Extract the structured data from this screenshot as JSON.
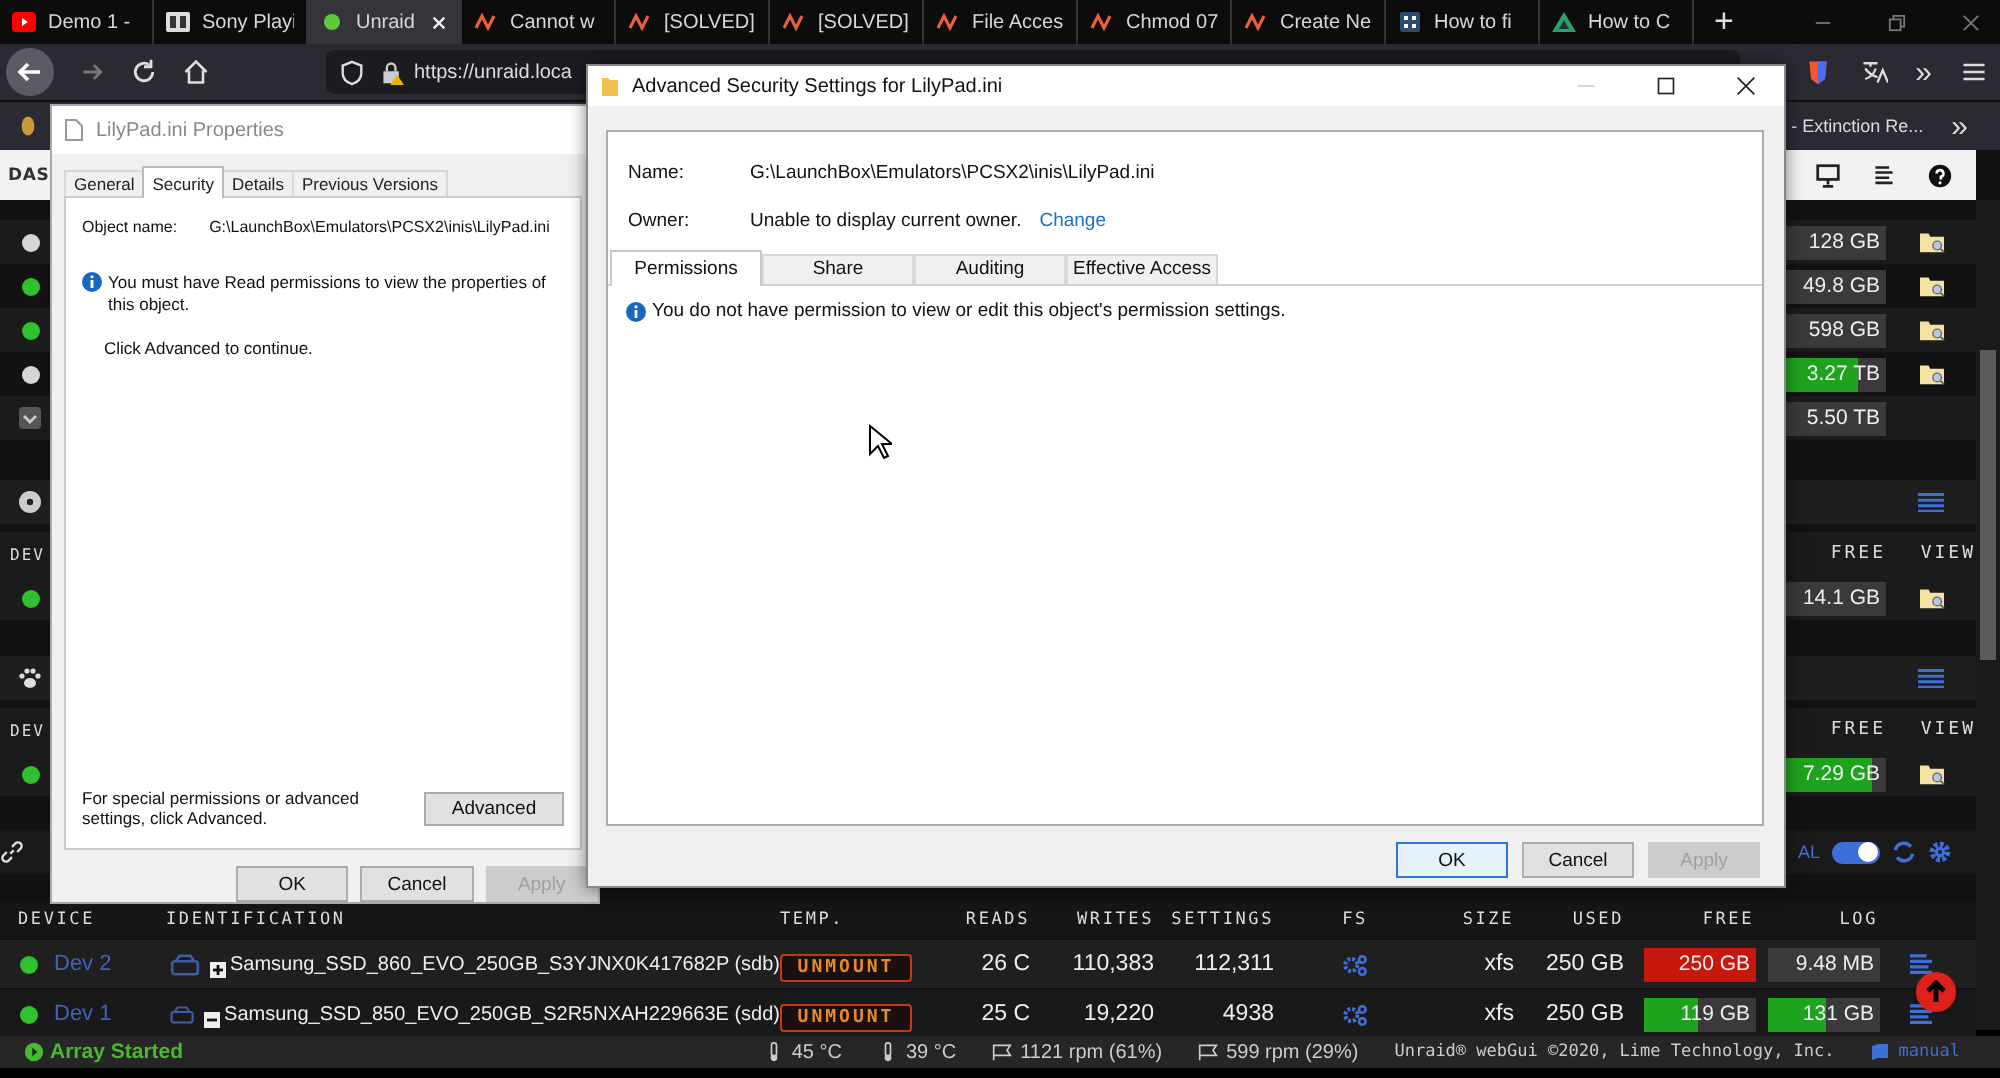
{
  "browser": {
    "tabs": [
      {
        "title": "Demo 1 -",
        "kind": "video",
        "selected": false
      },
      {
        "title": "Sony Playi",
        "kind": "letters",
        "selected": false
      },
      {
        "title": "Unraid",
        "kind": "dot",
        "selected": true
      },
      {
        "title": "Cannot w",
        "kind": "wave",
        "selected": false
      },
      {
        "title": "[SOLVED]",
        "kind": "wave",
        "selected": false
      },
      {
        "title": "[SOLVED]",
        "kind": "wave",
        "selected": false
      },
      {
        "title": "File Acces",
        "kind": "wave",
        "selected": false
      },
      {
        "title": "Chmod 07",
        "kind": "wave",
        "selected": false
      },
      {
        "title": "Create Ne",
        "kind": "wave",
        "selected": false
      },
      {
        "title": "How to fi",
        "kind": "grid",
        "selected": false
      },
      {
        "title": "How to C",
        "kind": "triangle",
        "selected": false
      }
    ],
    "new_tab": "+",
    "url": "https://unraid.loca",
    "bookmark": "- Extinction Re...",
    "bookmarks_more": "»",
    "toolbar_more": "»"
  },
  "page": {
    "title": "DAS",
    "array_rows": [
      {
        "kind": "disk",
        "color": "#d6d6d6",
        "free": "128 GB"
      },
      {
        "kind": "disk",
        "color": "#2fc12f",
        "free": "49.8 GB"
      },
      {
        "kind": "disk",
        "color": "#2fc12f",
        "free": "598 GB"
      },
      {
        "kind": "disk",
        "color": "#d6d6d6",
        "free": "3.27 TB",
        "level": 0.72
      },
      {
        "kind": "total",
        "free": "5.50 TB"
      }
    ],
    "sections": [
      {
        "kind": "disc",
        "column_1": "DEV",
        "free_label": "FREE",
        "view_label": "VIEW",
        "rows": [
          {
            "color": "#2fc12f",
            "free": "14.1 GB"
          }
        ]
      },
      {
        "kind": "paw",
        "column_1": "DEV",
        "free_label": "FREE",
        "view_label": "VIEW",
        "rows": [
          {
            "color": "#2fc12f",
            "free": "7.29 GB",
            "level": 0.86
          }
        ]
      }
    ],
    "toolbar": {
      "label": "AL",
      "toggle_on": true
    },
    "devices": {
      "columns": [
        "DEVICE",
        "IDENTIFICATION",
        "TEMP.",
        "READS",
        "WRITES",
        "SETTINGS",
        "FS",
        "SIZE",
        "USED",
        "FREE",
        "LOG"
      ],
      "rows": [
        {
          "color": "#2fc12f",
          "device": "Dev 2",
          "expanded": false,
          "identification": "Samsung_SSD_860_EVO_250GB_S3YJNX0K417682P (sdb)",
          "action": "UNMOUNT",
          "temp": "26 C",
          "reads": "110,383",
          "writes": "112,311",
          "fs": "xfs",
          "size": "250 GB",
          "used": {
            "text": "250 GB",
            "level": 1
          },
          "free": {
            "text": "9.48 MB"
          }
        },
        {
          "color": "#2fc12f",
          "device": "Dev 1",
          "expanded": true,
          "identification": "Samsung_SSD_850_EVO_250GB_S2R5NXAH229663E (sdd)",
          "action": "UNMOUNT",
          "temp": "25 C",
          "reads": "19,220",
          "writes": "4938",
          "fs": "xfs",
          "size": "250 GB",
          "used": {
            "text": "119 GB",
            "level": 0.48
          },
          "free": {
            "text": "131 GB",
            "level": 0.52
          }
        }
      ]
    }
  },
  "status_bar": {
    "array": "Array Started",
    "temps": [
      "45 °C",
      "39 °C"
    ],
    "fans": [
      "1121 rpm (61%)",
      "599 rpm (29%)"
    ],
    "footer": "Unraid® webGui ©2020, Lime Technology, Inc.",
    "manual": "manual"
  },
  "properties_dialog": {
    "title": "LilyPad.ini Properties",
    "tabs": [
      {
        "label": "General",
        "selected": false
      },
      {
        "label": "Security",
        "selected": true
      },
      {
        "label": "Details",
        "selected": false
      },
      {
        "label": "Previous Versions",
        "selected": false
      }
    ],
    "object_label": "Object name:",
    "object_value": "G:\\LaunchBox\\Emulators\\PCSX2\\inis\\LilyPad.ini",
    "message": "You must have Read permissions to view the properties of this object.",
    "hint": "Click Advanced to continue.",
    "advanced_text": "For special permissions or advanced settings, click Advanced.",
    "advanced_button": "Advanced",
    "buttons": [
      {
        "label": "OK",
        "disabled": false
      },
      {
        "label": "Cancel",
        "disabled": false
      },
      {
        "label": "Apply",
        "disabled": true
      }
    ]
  },
  "advanced_dialog": {
    "title": "Advanced Security Settings for LilyPad.ini",
    "name_label": "Name:",
    "name_value": "G:\\LaunchBox\\Emulators\\PCSX2\\inis\\LilyPad.ini",
    "owner_label": "Owner:",
    "owner_value": "Unable to display current owner.",
    "owner_link": "Change",
    "tabs": [
      {
        "label": "Permissions",
        "selected": true
      },
      {
        "label": "Share",
        "selected": false
      },
      {
        "label": "Auditing",
        "selected": false
      },
      {
        "label": "Effective Access",
        "selected": false
      }
    ],
    "message": "You do not have permission to view or edit this object's permission settings.",
    "buttons": [
      {
        "label": "OK",
        "disabled": false,
        "default": true
      },
      {
        "label": "Cancel",
        "disabled": false,
        "default": false
      },
      {
        "label": "Apply",
        "disabled": true,
        "default": false
      }
    ]
  }
}
